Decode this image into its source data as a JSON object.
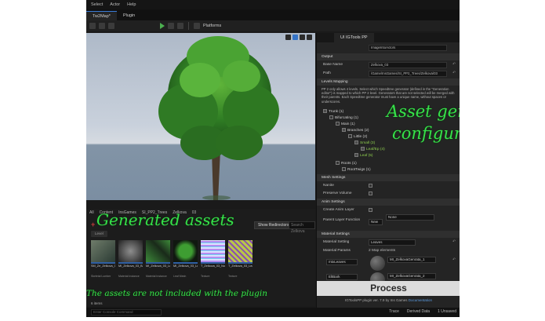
{
  "menu": [
    "Select",
    "Actor",
    "Help"
  ],
  "tabs": [
    {
      "label": "Tw2Map*",
      "active": true
    },
    {
      "label": "Plugin",
      "active": false
    }
  ],
  "toolbar": {
    "platforms_label": "Platforms"
  },
  "content_browser": {
    "breadcrumbs": [
      "All",
      "Content",
      "InsGames",
      "SI_PP2_Trees",
      "Zelkova",
      "03"
    ],
    "show_redirectors": "Show Redirectors",
    "search_placeholder": "Search Zelkova",
    "filter_chip": "Level",
    "assets": [
      {
        "name": "SM_Ze_Zelkova_03_Lod_x",
        "type": "Skeletal Lumber",
        "color_a": "#6f7c6a",
        "color_b": "#2a3a33"
      },
      {
        "name": "MI_Zelkova_03_Bark_x",
        "type": "Material Instance",
        "color_a": "#8e8e8e",
        "color_b": "#222"
      },
      {
        "name": "MI_Zelkova_03_Leaves_x",
        "type": "Material Instance",
        "color_a": "#3d8a3a",
        "color_b": "#1a2a1a"
      },
      {
        "name": "MI_Zelkova_03_Leaf",
        "type": "Leaf Mesh",
        "color_a": "#3e9d32",
        "color_b": "#101810"
      },
      {
        "name": "T_Zelkova_03_Normal_leaf_mask",
        "type": "Texture",
        "color_a": "#b58df0",
        "color_b": "#e0e0ff"
      },
      {
        "name": "T_Zelkova_03_Leaf_Alb",
        "type": "Texture",
        "color_a": "#b8c64a",
        "color_b": "#8a4fb0"
      }
    ],
    "item_count": "6 items"
  },
  "statusbar": {
    "cmd_placeholder": "Enter Console Command",
    "trace": "Trace",
    "derived_data": "Derived Data",
    "unsaved": "1 Unsaved"
  },
  "panel": {
    "tab_title": "UI IGTools PP",
    "top_value": "ImageIntoActors",
    "output_section": "Output",
    "base_name_label": "Base Name",
    "base_name_value": "Zelkova_03",
    "path_label": "Path",
    "path_value": "/Game/InsGames/SI_PP2_Trees/Zelkova/03",
    "levels_section": "Levels Mapping",
    "description": "PP 2 only allows 4 levels. Select which Speedtree generator (defined in the \"Generation editor\") is mapped to which PP 2 level. Generators that are not selected will be merged with their parents. Each Speedtree generator must have a unique name, without spaces or underscores.",
    "tree": [
      {
        "label": "Trunk (1)",
        "indent": 0,
        "green": false
      },
      {
        "label": "Bifurcating (1)",
        "indent": 1,
        "green": false
      },
      {
        "label": "Main (1)",
        "indent": 2,
        "green": false
      },
      {
        "label": "Branches (2)",
        "indent": 3,
        "green": false
      },
      {
        "label": "Little (2)",
        "indent": 4,
        "green": false
      },
      {
        "label": "Small (3)",
        "indent": 5,
        "green": true
      },
      {
        "label": "Leaf/Ep (4)",
        "indent": 6,
        "green": true
      },
      {
        "label": "Leaf (5)",
        "indent": 5,
        "green": true
      },
      {
        "label": "Roots (1)",
        "indent": 2,
        "green": false
      },
      {
        "label": "RootTwigs (1)",
        "indent": 3,
        "green": false
      }
    ],
    "mesh_section": "Mesh Settings",
    "nanite_label": "Nanite",
    "preserve_volume_label": "Preserve Volume",
    "anim_section": "Anim Settings",
    "create_anim_layer_label": "Create Anim Layer",
    "parent_layer_function_label": "Parent Layer Function",
    "parent_layer_new": "New",
    "parent_layer_value": "None",
    "material_section": "Material Settings",
    "material_setting_label": "Material Setting",
    "material_setting_value": "Leaves",
    "material_params_label": "Material Params",
    "material_params_value": "2 Map elements",
    "leaves_label": "mtxLeaves",
    "leaves_value": "MI_ZelkovaGenrata_1",
    "bark_label": "EltBark",
    "bark_value": "MI_ZelkovaGenrata_2",
    "process_label": "Process",
    "footer_text": "IGToolsPP plugin ver. 7.9 by Ins Games",
    "footer_link": "Documentation"
  },
  "overlays": {
    "generated_assets": "Generated assets",
    "not_included": "The assets are not included with the plugin",
    "asset_gen_line1": "Asset gene",
    "asset_gen_line2": "configura"
  },
  "colors": {
    "accent_blue": "#3a7bd5",
    "overlay_green": "#36e04a",
    "tree_green": "#8fcf4f"
  }
}
